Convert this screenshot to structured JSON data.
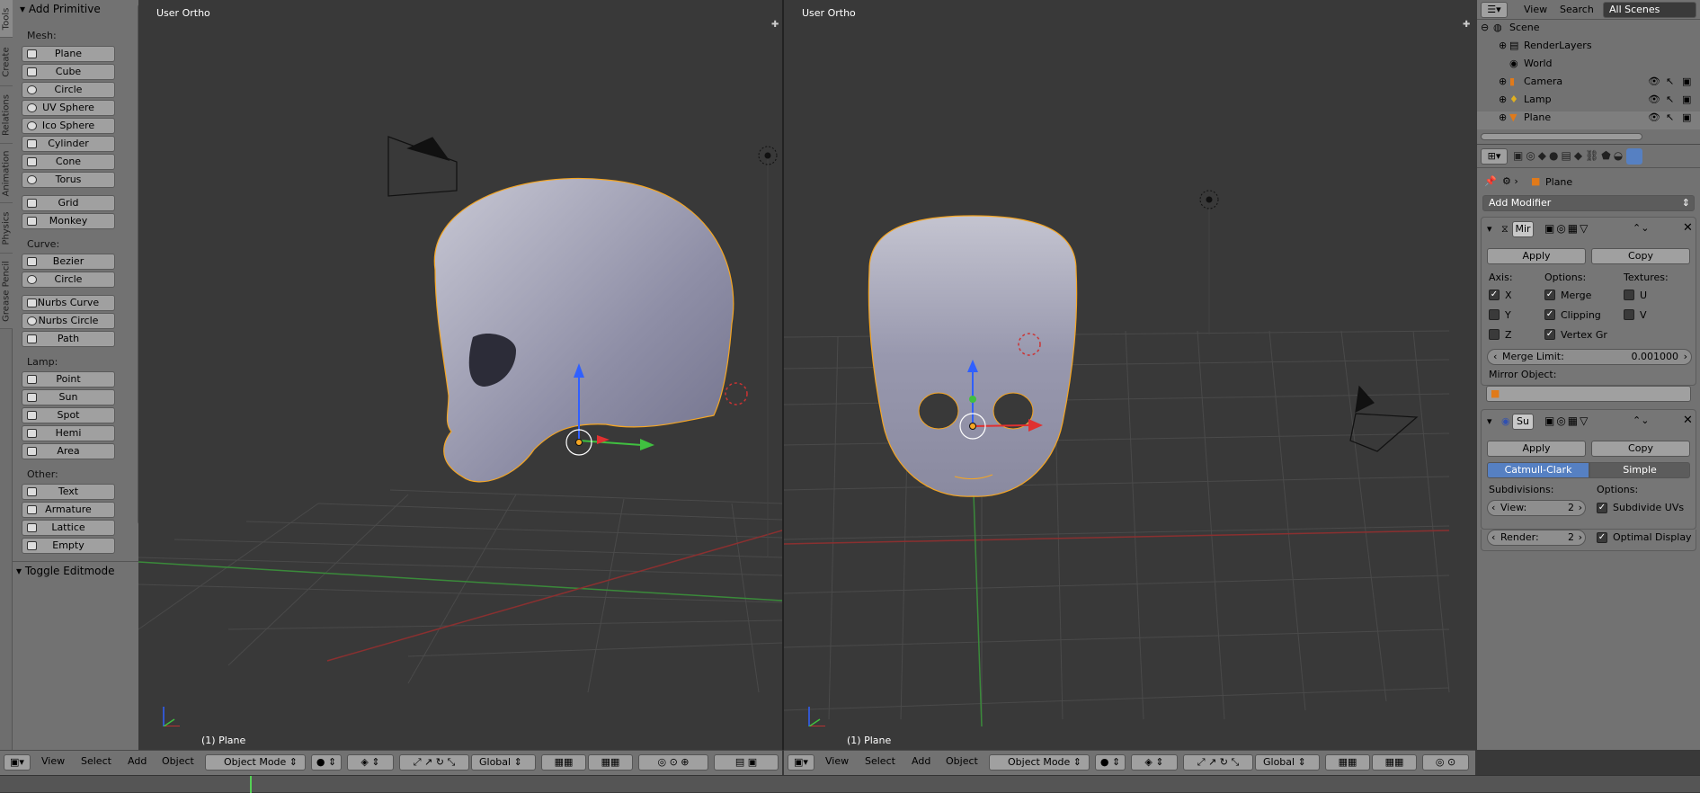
{
  "left_tabs": [
    "Tools",
    "Create",
    "Relations",
    "Animation",
    "Physics",
    "Grease Pencil"
  ],
  "toolshelf": {
    "header": "Add Primitive",
    "sections": [
      {
        "label": "Mesh:",
        "items": [
          "Plane",
          "Cube",
          "Circle",
          "UV Sphere",
          "Ico Sphere",
          "Cylinder",
          "Cone",
          "Torus",
          "Grid",
          "Monkey"
        ]
      },
      {
        "label": "Curve:",
        "items": [
          "Bezier",
          "Circle",
          "Nurbs Curve",
          "Nurbs Circle",
          "Path"
        ]
      },
      {
        "label": "Lamp:",
        "items": [
          "Point",
          "Sun",
          "Spot",
          "Hemi",
          "Area"
        ]
      },
      {
        "label": "Other:",
        "items": [
          "Text",
          "Armature",
          "Lattice",
          "Empty"
        ]
      }
    ],
    "toggle_editmode": "Toggle Editmode"
  },
  "viewport_left": {
    "label": "User Ortho",
    "object_name": "(1) Plane"
  },
  "viewport_right": {
    "label": "User Ortho",
    "object_name": "(1) Plane"
  },
  "header": {
    "menus": [
      "View",
      "Select",
      "Add",
      "Object"
    ],
    "mode": "Object Mode",
    "orientation": "Global"
  },
  "outliner": {
    "menus": [
      "View",
      "Search"
    ],
    "scene_filter": "All Scenes",
    "items": [
      "Scene",
      "RenderLayers",
      "World",
      "Camera",
      "Lamp",
      "Plane"
    ]
  },
  "properties": {
    "object_name": "Plane",
    "add_modifier": "Add Modifier",
    "mirror": {
      "name": "Mir",
      "apply": "Apply",
      "copy": "Copy",
      "axis_label": "Axis:",
      "options_label": "Options:",
      "textures_label": "Textures:",
      "axes": [
        "X",
        "Y",
        "Z"
      ],
      "options": [
        "Merge",
        "Clipping",
        "Vertex Gr"
      ],
      "textures": [
        "U",
        "V"
      ],
      "merge_limit_label": "Merge Limit:",
      "merge_limit_value": "0.001000",
      "mirror_object_label": "Mirror Object:"
    },
    "subsurf": {
      "name": "Su",
      "apply": "Apply",
      "copy": "Copy",
      "algo_active": "Catmull-Clark",
      "algo_other": "Simple",
      "subdiv_label": "Subdivisions:",
      "options_label": "Options:",
      "view_label": "View:",
      "view_value": "2",
      "render_label": "Render:",
      "render_value": "2",
      "subdivide_uvs": "Subdivide UVs",
      "optimal_display": "Optimal Display"
    }
  },
  "colors": {
    "accent": "#5680c2",
    "selection": "#f5a623",
    "x_axis": "#e03030",
    "y_axis": "#40c040",
    "z_axis": "#3060ff"
  }
}
